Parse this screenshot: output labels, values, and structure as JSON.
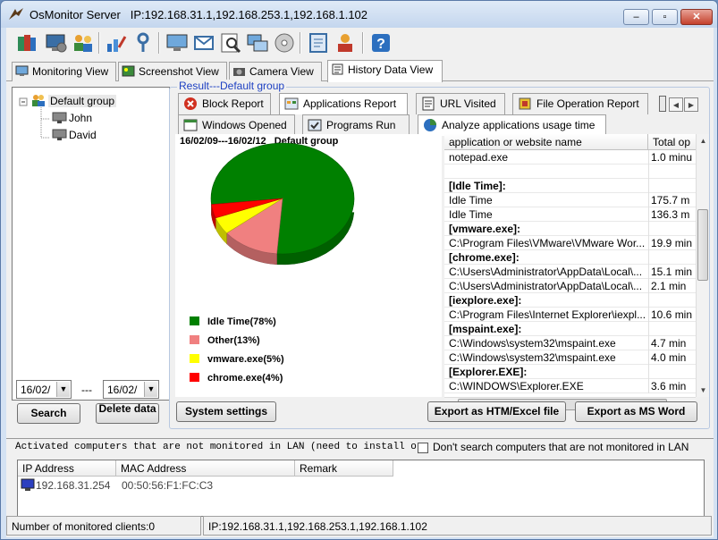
{
  "window": {
    "title": "OsMonitor Server",
    "ip_label": "IP:192.168.31.1,192.168.253.1,192.168.1.102",
    "min": "–",
    "max": "▫",
    "close": "✕"
  },
  "view_tabs": [
    {
      "label": "Monitoring View",
      "icon": "monitoring-view-icon"
    },
    {
      "label": "Screenshot View",
      "icon": "screenshot-view-icon"
    },
    {
      "label": "Camera View",
      "icon": "camera-view-icon"
    },
    {
      "label": "History Data View",
      "icon": "history-data-icon"
    }
  ],
  "tree": {
    "group": "Default group",
    "users": [
      "John",
      "David"
    ]
  },
  "dates": {
    "from": "16/02/",
    "to": "16/02/",
    "separator": "---"
  },
  "left_buttons": {
    "search": "Search",
    "delete": "Delete data"
  },
  "result": {
    "legend": "Result---Default group"
  },
  "report_tabs": [
    {
      "label": "Block Report",
      "icon": "block-icon"
    },
    {
      "label": "Applications Report",
      "icon": "apps-icon"
    },
    {
      "label": "URL Visited",
      "icon": "url-icon"
    },
    {
      "label": "File Operation Report",
      "icon": "file-op-icon"
    },
    {
      "label": "Windows Opened",
      "icon": "window-icon"
    },
    {
      "label": "Programs Run",
      "icon": "programs-icon"
    },
    {
      "label": "Analyze applications usage time",
      "icon": "analyze-icon"
    }
  ],
  "chart_data": {
    "type": "pie",
    "title": "16/02/09---16/02/12   Default group",
    "slices": [
      {
        "label": "Idle Time(78%)",
        "value": 78,
        "color": "#008000"
      },
      {
        "label": "Other(13%)",
        "value": 13,
        "color": "#f08080"
      },
      {
        "label": "vmware.exe(5%)",
        "value": 5,
        "color": "#ffff00"
      },
      {
        "label": "chrome.exe(4%)",
        "value": 4,
        "color": "#ff0000"
      }
    ]
  },
  "table": {
    "headers": [
      "application or website name",
      "Total op"
    ],
    "rows": [
      {
        "name": "notepad.exe",
        "time": "1.0 minu"
      },
      {
        "name": "",
        "time": ""
      },
      {
        "name": "[Idle Time]:",
        "time": "",
        "bold": true
      },
      {
        "name": "Idle Time",
        "time": "175.7 m"
      },
      {
        "name": "Idle Time",
        "time": "136.3 m"
      },
      {
        "name": "[vmware.exe]:",
        "time": "",
        "bold": true
      },
      {
        "name": "C:\\Program Files\\VMware\\VMware Wor...",
        "time": "19.9 min"
      },
      {
        "name": "[chrome.exe]:",
        "time": "",
        "bold": true
      },
      {
        "name": "C:\\Users\\Administrator\\AppData\\Local\\...",
        "time": "15.1 min"
      },
      {
        "name": "C:\\Users\\Administrator\\AppData\\Local\\...",
        "time": "2.1 min"
      },
      {
        "name": "[iexplore.exe]:",
        "time": "",
        "bold": true
      },
      {
        "name": "C:\\Program Files\\Internet Explorer\\iexpl...",
        "time": "10.6 min"
      },
      {
        "name": "[mspaint.exe]:",
        "time": "",
        "bold": true
      },
      {
        "name": "C:\\Windows\\system32\\mspaint.exe",
        "time": "4.7 min"
      },
      {
        "name": "C:\\Windows\\system32\\mspaint.exe",
        "time": "4.0 min"
      },
      {
        "name": "[Explorer.EXE]:",
        "time": "",
        "bold": true
      },
      {
        "name": "C:\\WINDOWS\\Explorer.EXE",
        "time": "3.6 min"
      }
    ]
  },
  "bottom_buttons": {
    "settings": "System settings",
    "export_htm": "Export as HTM/Excel file",
    "export_word": "Export as MS Word"
  },
  "lan": {
    "text": "Activated computers that are not monitored in LAN (need to install or run C",
    "checkbox_label": "Don't search computers that are not monitored in LAN",
    "headers": [
      "IP Address",
      "MAC Address",
      "Remark"
    ],
    "rows": [
      {
        "ip": "192.168.31.254",
        "mac": "00:50:56:F1:FC:C3",
        "remark": ""
      }
    ]
  },
  "status": {
    "clients": "Number of monitored clients:0",
    "ip": "IP:192.168.31.1,192.168.253.1,192.168.1.102"
  }
}
